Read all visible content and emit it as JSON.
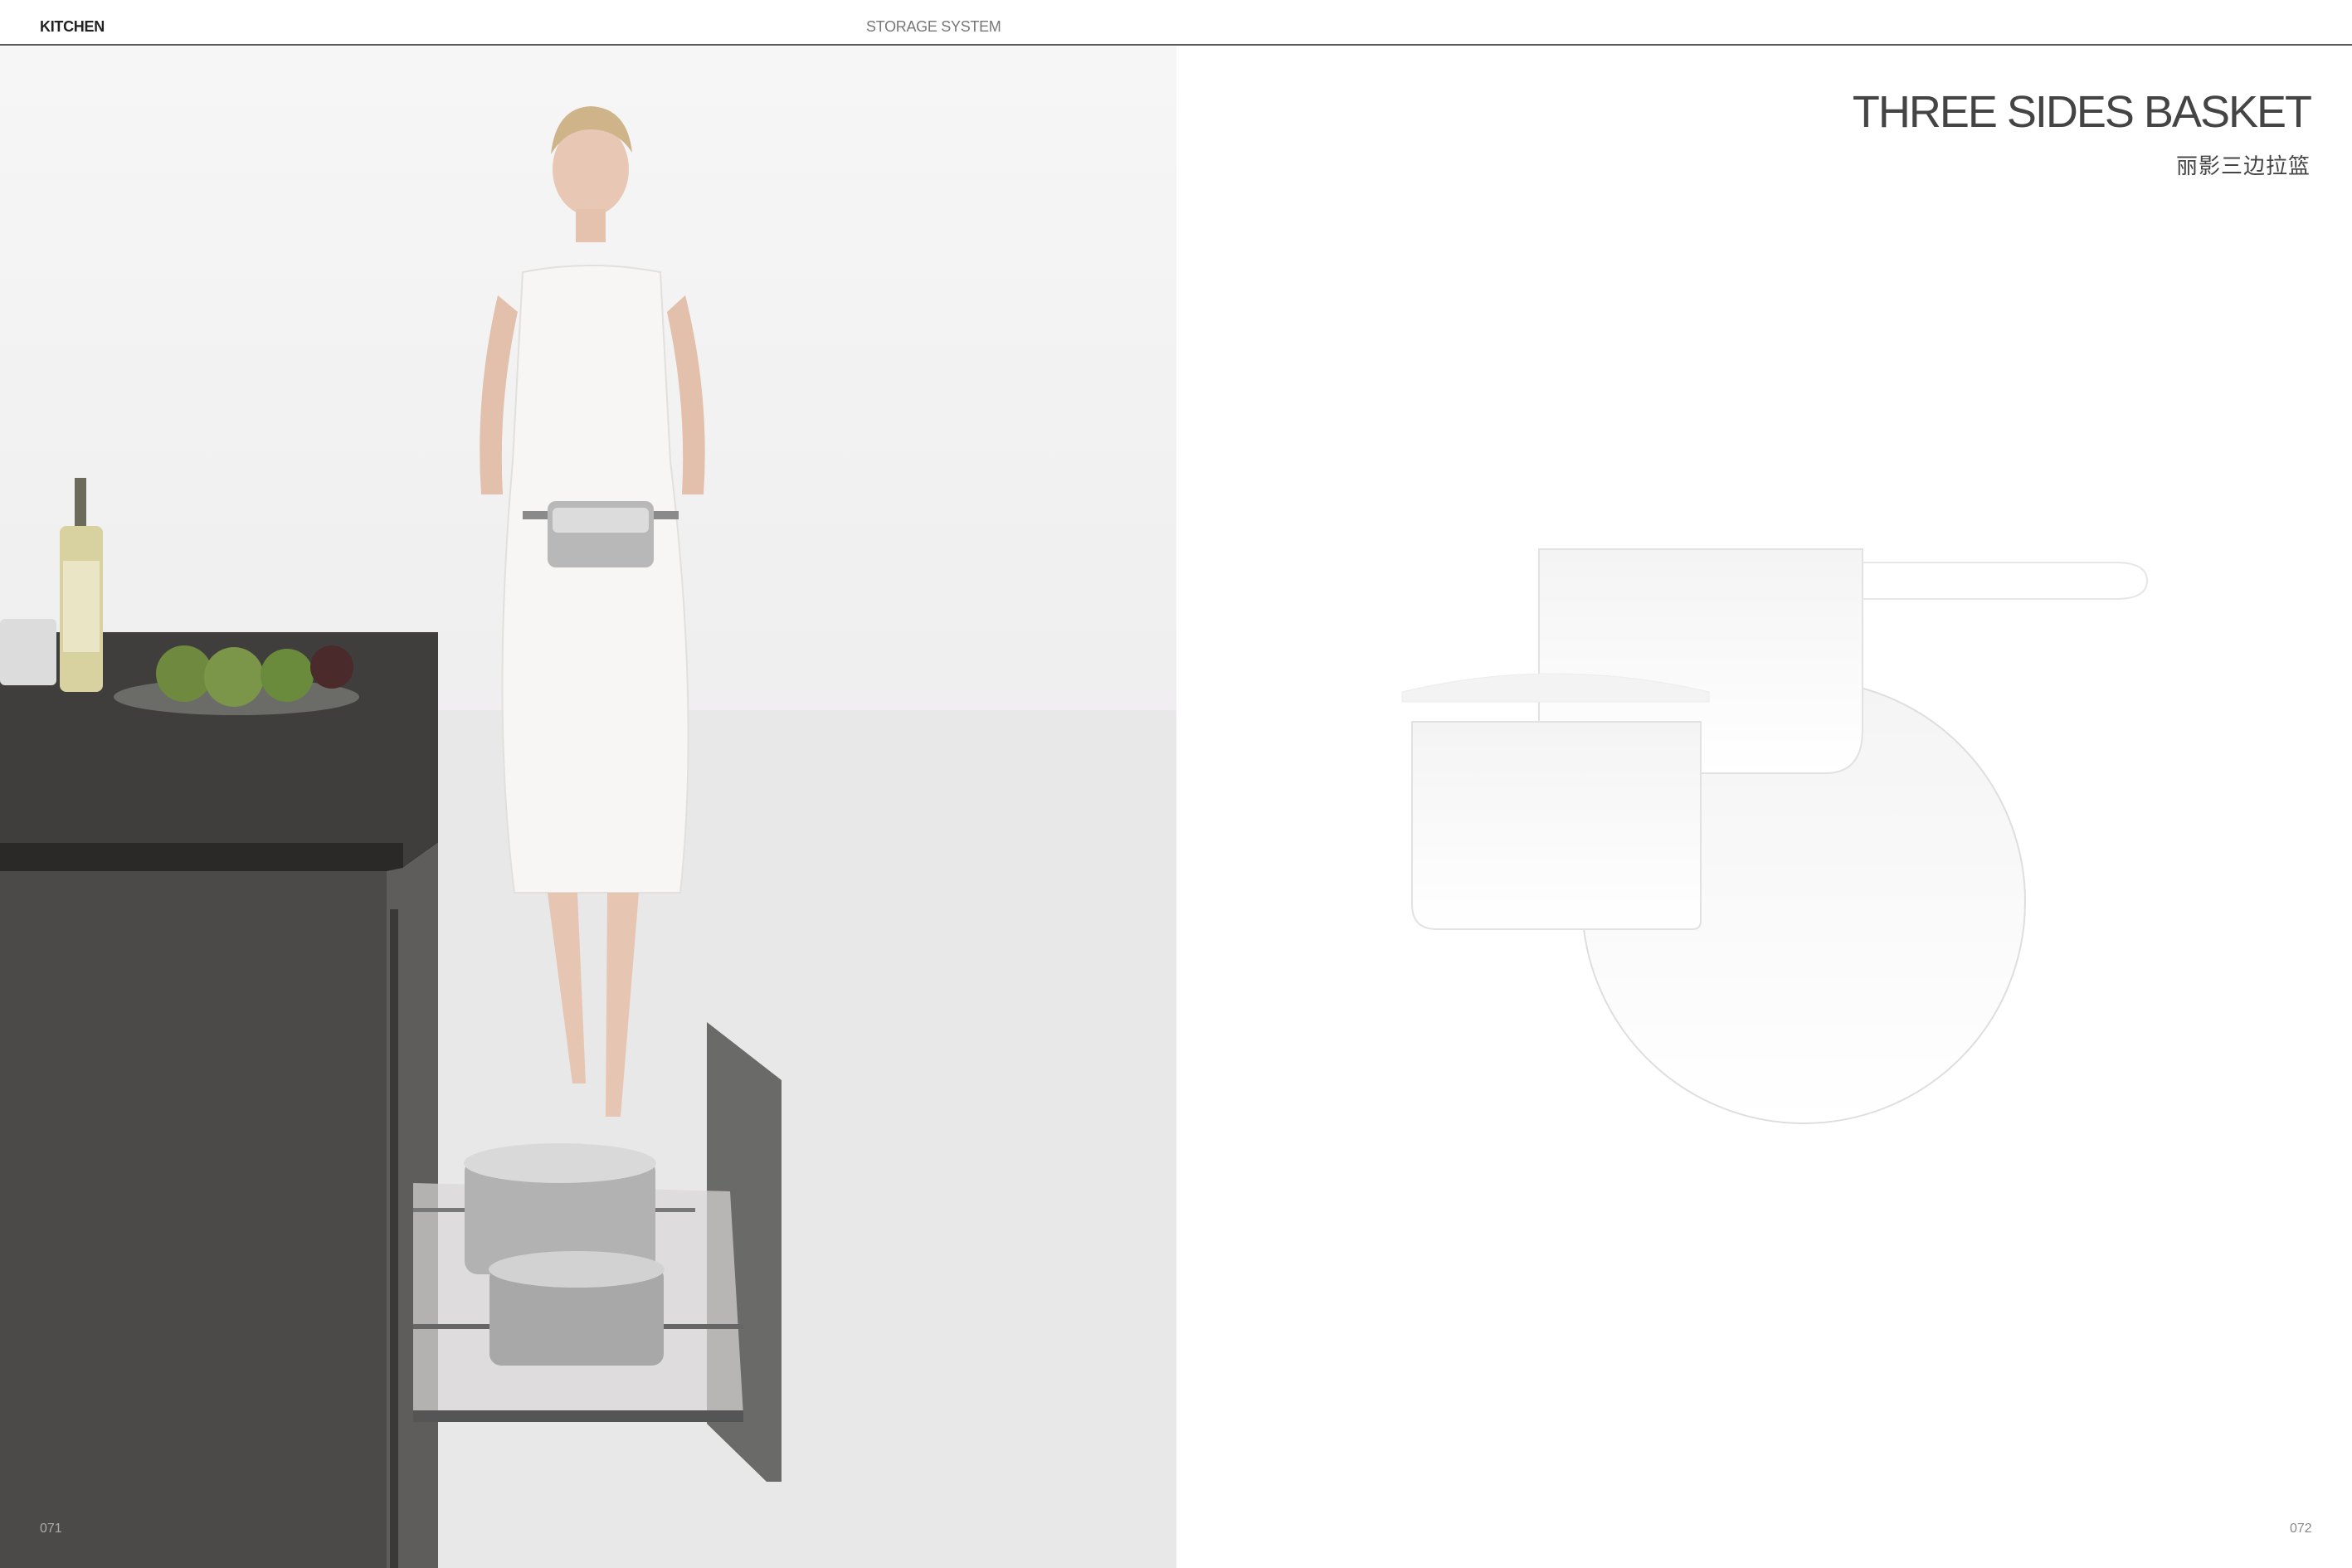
{
  "header": {
    "section": "KITCHEN",
    "category": "STORAGE SYSTEM"
  },
  "product": {
    "title": "THREE SIDES BASKET",
    "subtitle_cn": "丽影三边拉篮"
  },
  "folios": {
    "left": "071",
    "right": "072"
  },
  "photo": {
    "label": "lifestyle-photo-kitchen-drawer-basket"
  },
  "colors": {
    "rule": "#5a5a5a",
    "cabinet": "#4b4a48",
    "countertop": "#3e3d3c",
    "title_text": "#444444"
  }
}
